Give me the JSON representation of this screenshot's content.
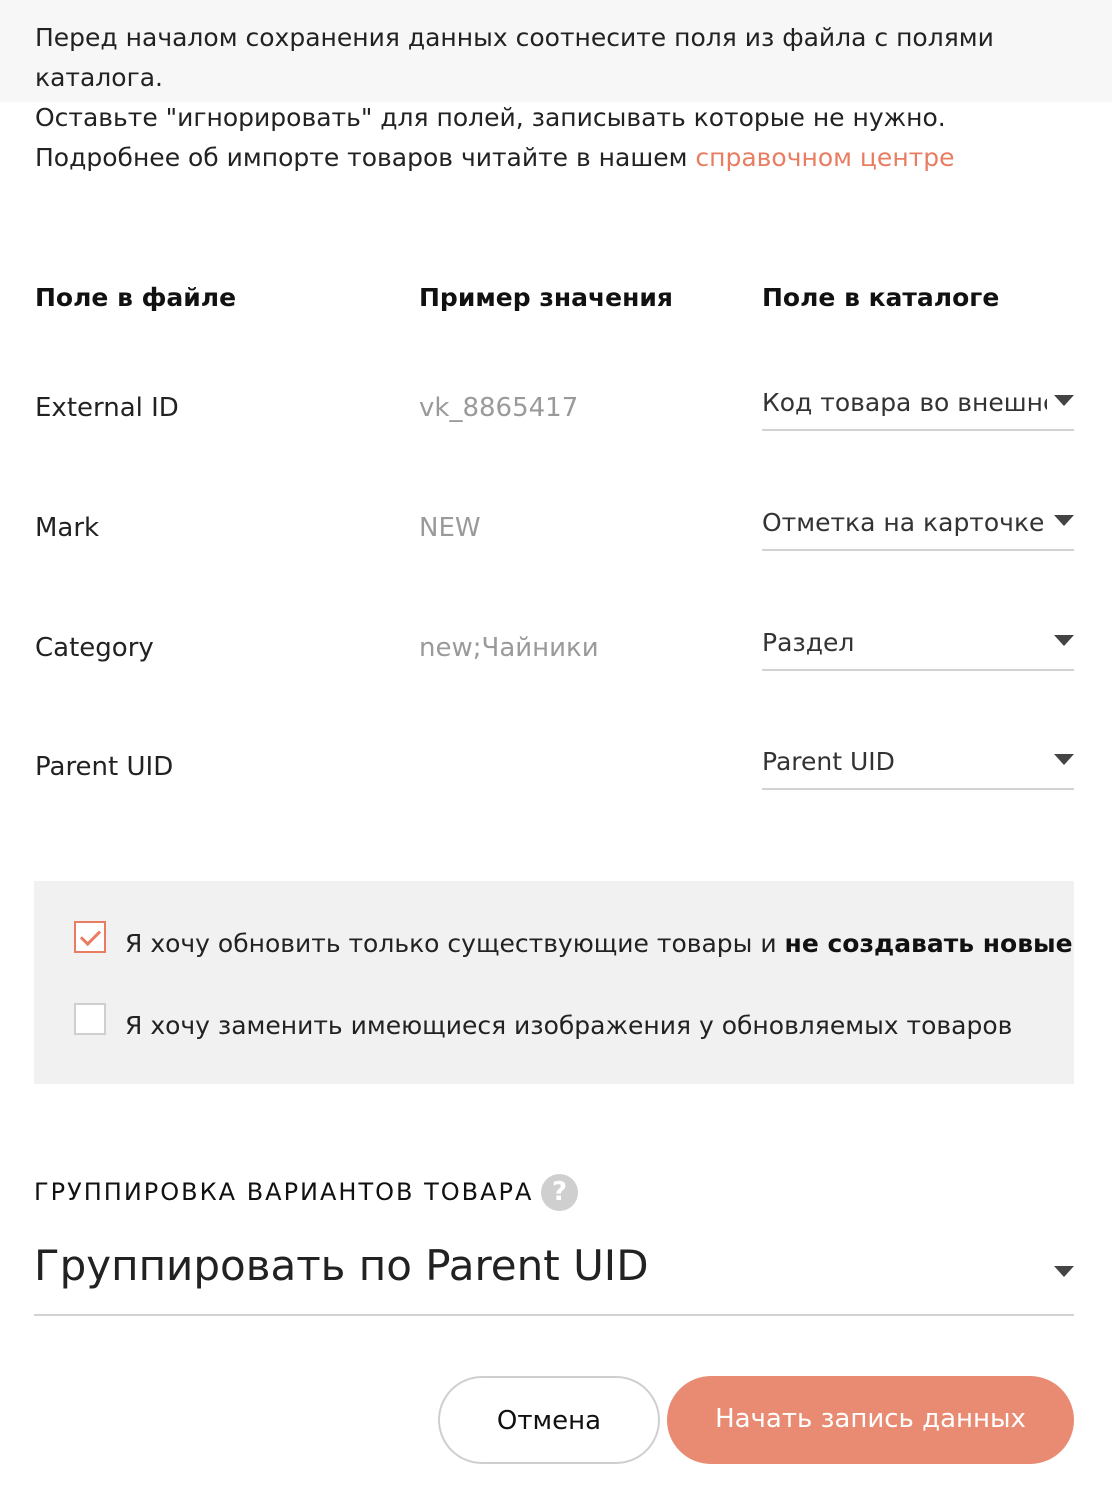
{
  "intro": {
    "line1": "Перед началом сохранения данных соотнесите поля из файла с полями каталога.",
    "line2": "Оставьте \"игнорировать\" для полей, записывать которые не нужно."
  },
  "help": {
    "text": "Подробнее об импорте товаров читайте в нашем ",
    "link": "справочном центре"
  },
  "columns": {
    "file_field": "Поле в файле",
    "sample": "Пример значения",
    "catalog_field": "Поле в каталоге"
  },
  "rows": [
    {
      "file_field": "External ID",
      "sample": "vk_8865417",
      "catalog_field": "Код товара во внешне"
    },
    {
      "file_field": "Mark",
      "sample": "NEW",
      "catalog_field": "Отметка на карточке"
    },
    {
      "file_field": "Category",
      "sample": "new;Чайники",
      "catalog_field": "Раздел"
    },
    {
      "file_field": "Parent UID",
      "sample": "",
      "catalog_field": "Parent UID"
    }
  ],
  "options": {
    "update_only": {
      "checked": true,
      "text": "Я хочу обновить только существующие товары и ",
      "bold": "не создавать новые"
    },
    "replace_images": {
      "checked": false,
      "text": "Я хочу заменить имеющиеся изображения у обновляемых товаров"
    }
  },
  "grouping": {
    "title": "ГРУППИРОВКА ВАРИАНТОВ ТОВАРА",
    "help_icon": "?",
    "value": "Группировать по Parent UID"
  },
  "buttons": {
    "cancel": "Отмена",
    "start": "Начать запись данных"
  },
  "colors": {
    "accent": "#e97d62",
    "start_button": "#e98b72"
  }
}
